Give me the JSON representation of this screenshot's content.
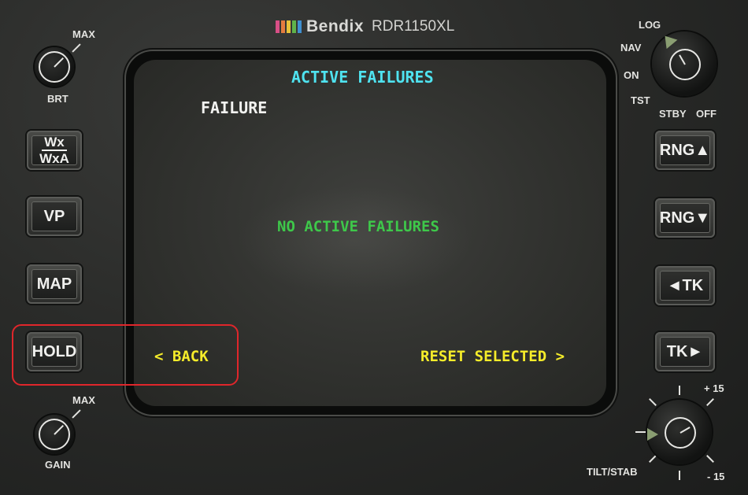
{
  "brand": {
    "name": "Bendix",
    "model": "RDR1150XL",
    "bar_colors": [
      "#d84f86",
      "#e47c3f",
      "#e8c23a",
      "#5fb34a",
      "#3f8fd0"
    ]
  },
  "display": {
    "title": "ACTIVE FAILURES",
    "column_header": "FAILURE",
    "message": "NO ACTIVE FAILURES",
    "left_softkey": "< BACK",
    "right_softkey": "RESET SELECTED >",
    "colors": {
      "title": "#4fe3f0",
      "message": "#3ec84a",
      "softkey": "#f5ec2a",
      "header": "#f2f2f0"
    }
  },
  "left_buttons": {
    "wx_top": "Wx",
    "wx_bottom": "WxA",
    "vp": "VP",
    "map": "MAP",
    "hold": "HOLD"
  },
  "right_buttons": {
    "rng_up": "RNG▲",
    "rng_down": "RNG▼",
    "tk_left": "◄TK",
    "tk_right": "TK►"
  },
  "knobs": {
    "brt_label": "BRT",
    "brt_max": "MAX",
    "gain_label": "GAIN",
    "gain_max": "MAX",
    "mode_positions": [
      "LOG",
      "NAV",
      "ON",
      "TST",
      "STBY",
      "OFF"
    ],
    "tilt_label": "TILT/STAB",
    "tilt_plus": "+ 15",
    "tilt_minus": "- 15"
  },
  "highlight_color": "#e0262b"
}
